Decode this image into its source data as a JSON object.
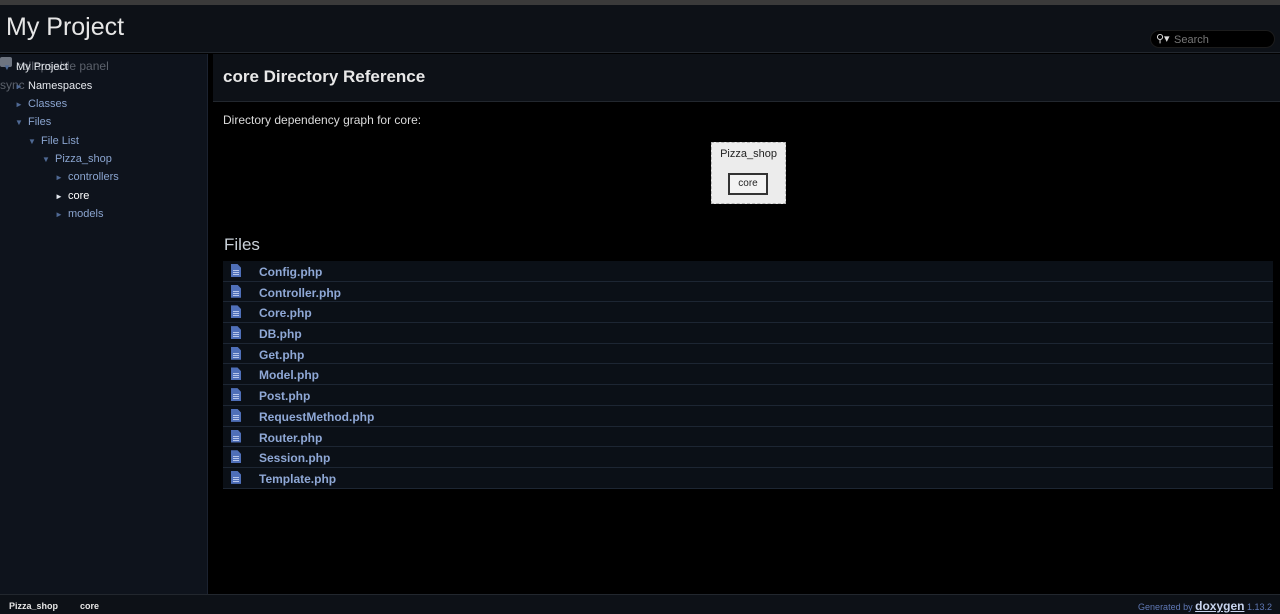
{
  "header": {
    "project_name": "My Project",
    "search_placeholder": "Search"
  },
  "sidebar": {
    "ghost_line_1": "Ⓡ collapsable panel",
    "ghost_line_2": "sync",
    "items": [
      {
        "label": "My Project",
        "arrow": "▼",
        "state": "expanded"
      },
      {
        "label": "Namespaces",
        "arrow": "►",
        "state": "collapsed"
      },
      {
        "label": "Classes",
        "arrow": "►",
        "state": "collapsed"
      },
      {
        "label": "Files",
        "arrow": "▼",
        "state": "expanded"
      },
      {
        "label": "File List",
        "arrow": "▼",
        "state": "expanded"
      },
      {
        "label": "Pizza_shop",
        "arrow": "▼",
        "state": "expanded"
      },
      {
        "label": "controllers",
        "arrow": "►",
        "state": "collapsed"
      },
      {
        "label": "core",
        "arrow": "►",
        "state": "selected"
      },
      {
        "label": "models",
        "arrow": "►",
        "state": "collapsed"
      }
    ]
  },
  "main": {
    "title": "core Directory Reference",
    "graph_label": "Directory dependency graph for core:",
    "graph": {
      "parent": "Pizza_shop",
      "child": "core"
    },
    "files_heading": "Files",
    "files": [
      "Config.php",
      "Controller.php",
      "Core.php",
      "DB.php",
      "Get.php",
      "Model.php",
      "Post.php",
      "RequestMethod.php",
      "Router.php",
      "Session.php",
      "Template.php"
    ]
  },
  "footer": {
    "breadcrumb": [
      "Pizza_shop",
      "core"
    ],
    "generated_by": "Generated by",
    "doxygen": "doxygen",
    "version": "1.13.2"
  },
  "colors": {
    "background": "#000000",
    "header": "#0d1117",
    "sidebar": "#0e131c",
    "link": "#8fa8d6",
    "file_icon": "#4f6fb8"
  }
}
